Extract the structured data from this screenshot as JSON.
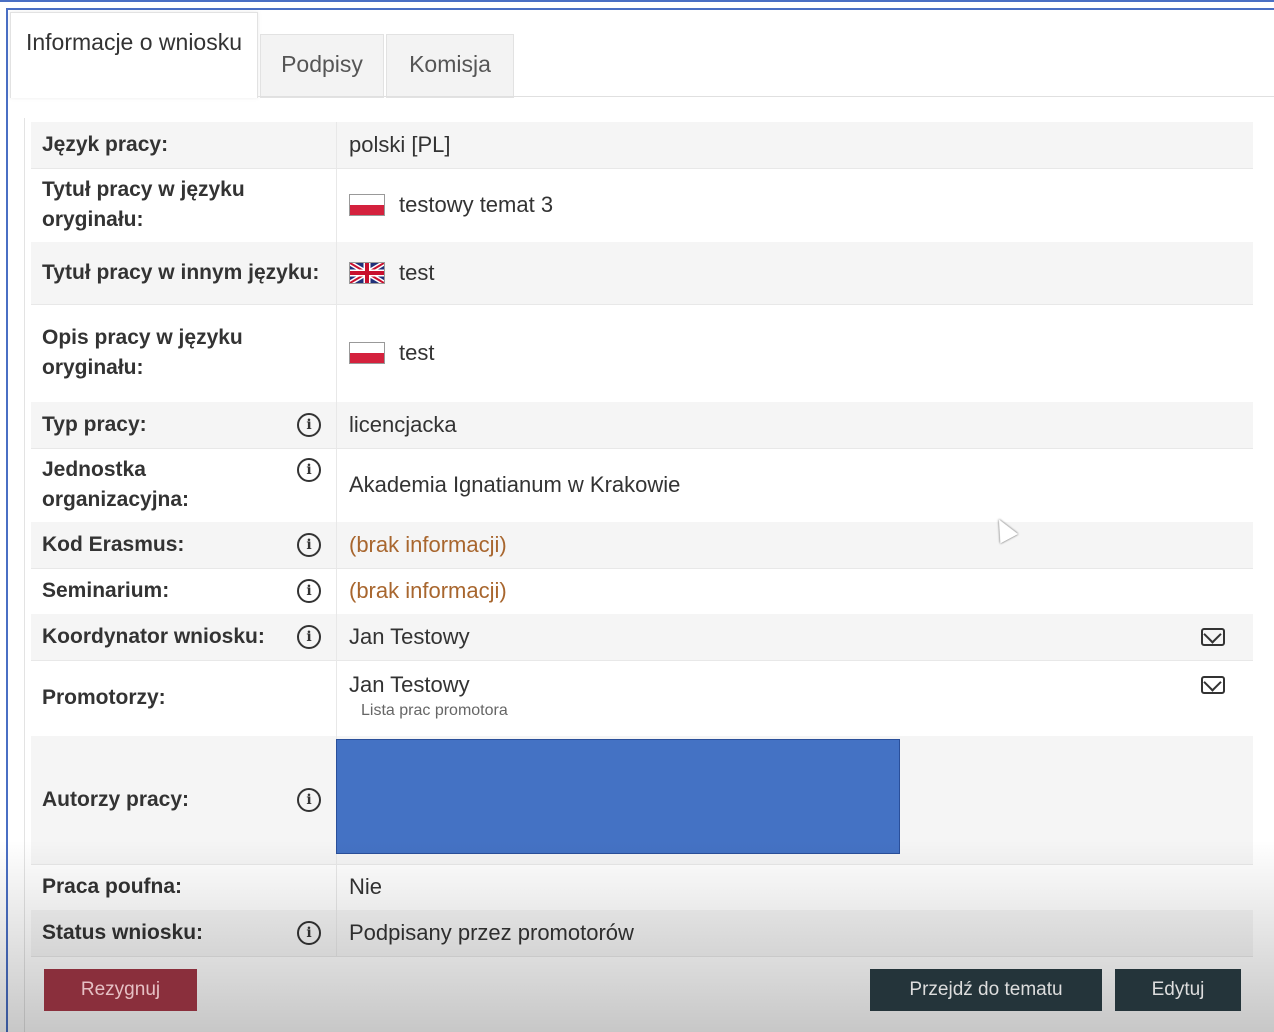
{
  "tabs": [
    {
      "label": "Informacje o wniosku"
    },
    {
      "label": "Podpisy"
    },
    {
      "label": "Komisja"
    }
  ],
  "rows": [
    {
      "label": "Język pracy:",
      "value": "polski [PL]"
    },
    {
      "label": "Tytuł pracy w języku oryginału:",
      "value": "testowy temat 3",
      "flag": "pl-flag-icon"
    },
    {
      "label": "Tytuł pracy w innym języku:",
      "value": "test",
      "flag": "uk-flag-icon"
    },
    {
      "label": "Opis pracy w języku oryginału:",
      "value": "test",
      "flag": "pl-flag-icon"
    },
    {
      "label": "Typ pracy:",
      "value": "licencjacka"
    },
    {
      "label": "Jednostka organizacyjna:",
      "value": "Akademia Ignatianum w Krakowie"
    },
    {
      "label": "Kod Erasmus:",
      "value": "(brak informacji)"
    },
    {
      "label": "Seminarium:",
      "value": "(brak informacji)"
    },
    {
      "label": "Koordynator wniosku:",
      "value": "Jan Testowy"
    },
    {
      "label": "Promotorzy:",
      "value": "Jan Testowy",
      "sub_link": "Lista prac promotora"
    },
    {
      "label": "Autorzy pracy:",
      "value": ""
    },
    {
      "label": "Praca poufna:",
      "value": "Nie"
    },
    {
      "label": "Status wniosku:",
      "value": "Podpisany przez promotorów"
    }
  ],
  "buttons": {
    "resign": "Rezygnuj",
    "go_to_topic": "Przejdź do tematu",
    "edit": "Edytuj"
  },
  "colors": {
    "accent_border": "#4a6fc4",
    "missing_info": "#a8662e",
    "resign_button": "#8a2f3c",
    "dark_button": "#24343a",
    "redaction": "#4472c4"
  }
}
